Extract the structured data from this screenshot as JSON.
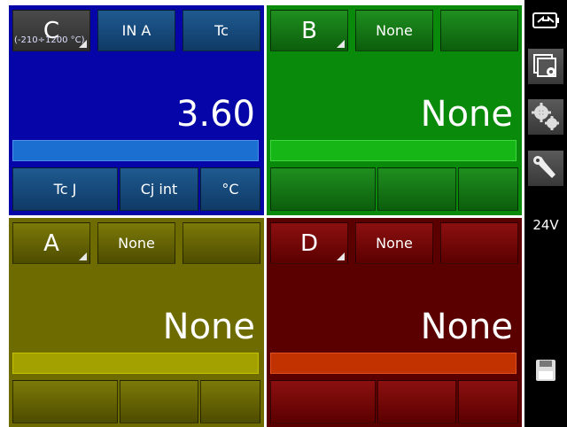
{
  "channels": {
    "C": {
      "label": "C",
      "mode": "IN A",
      "sensor": "Tc",
      "range": "(-210÷1200 °C)",
      "reading": "3.60",
      "bottom": [
        "Tc J",
        "Cj int",
        "°C"
      ]
    },
    "B": {
      "label": "B",
      "mode": "None",
      "reading": "None"
    },
    "A": {
      "label": "A",
      "mode": "None",
      "reading": "None"
    },
    "D": {
      "label": "D",
      "mode": "None",
      "reading": "None"
    }
  },
  "sidebar": {
    "voltage_label": "24V",
    "icons": [
      "power-plug-icon",
      "window-settings-icon",
      "gears-icon",
      "wrench-icon",
      "save-icon"
    ]
  },
  "colors": {
    "C_panel": "#0505a8",
    "B_panel": "#0a8a0a",
    "A_panel": "#6e6c00",
    "D_panel": "#5a0000"
  }
}
